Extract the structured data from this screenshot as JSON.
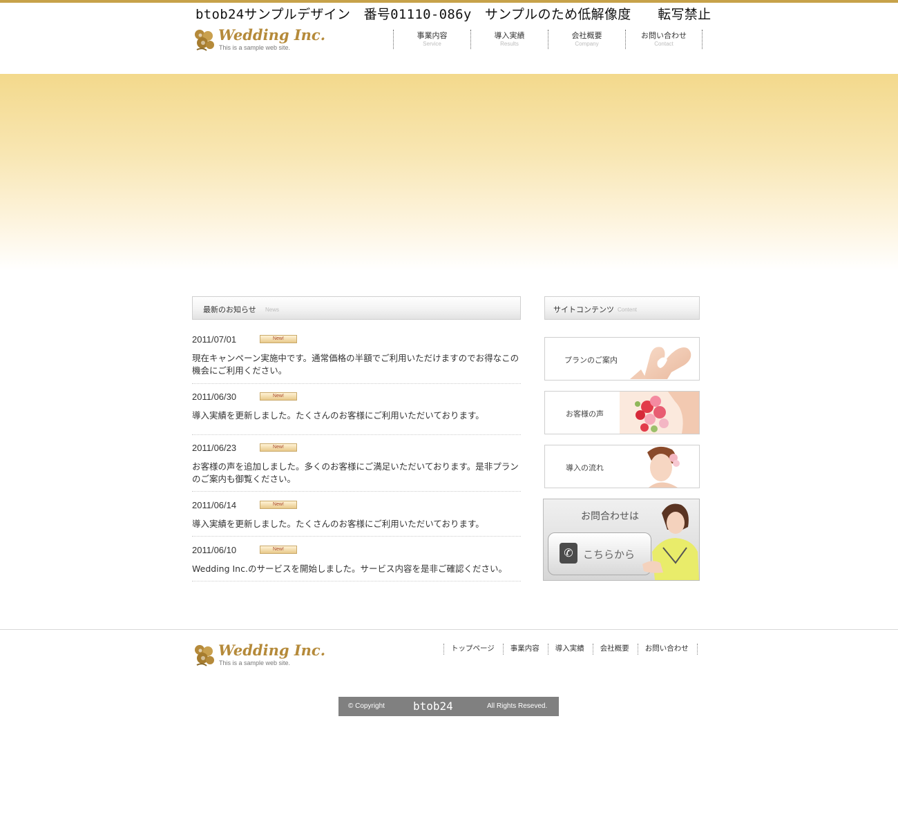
{
  "watermark": "btob24サンプルデザイン　番号01110-086y　サンプルのため低解像度　　転写禁止",
  "header": {
    "brand": "Wedding Inc.",
    "tagline": "This is a sample web site."
  },
  "nav": [
    {
      "jp": "事業内容",
      "en": "Service"
    },
    {
      "jp": "導入実績",
      "en": "Results"
    },
    {
      "jp": "会社概要",
      "en": "Company"
    },
    {
      "jp": "お問い合わせ",
      "en": "Contact"
    }
  ],
  "news": {
    "title": "最新のお知らせ",
    "title_en": "News",
    "badge": "New!",
    "items": [
      {
        "date": "2011/07/01",
        "text": "現在キャンペーン実施中です。通常価格の半額でご利用いただけますのでお得なこの機会にご利用ください。"
      },
      {
        "date": "2011/06/30",
        "text": "導入実績を更新しました。たくさんのお客様にご利用いただいております。"
      },
      {
        "date": "2011/06/23",
        "text": "お客様の声を追加しました。多くのお客様にご満足いただいております。是非プランのご案内も御覧ください。"
      },
      {
        "date": "2011/06/14",
        "text": "導入実績を更新しました。たくさんのお客様にご利用いただいております。"
      },
      {
        "date": "2011/06/10",
        "text": "Wedding Inc.のサービスを開始しました。サービス内容を是非ご確認ください。"
      }
    ]
  },
  "sidebar": {
    "title": "サイトコンテンツ",
    "title_en": "Content",
    "banners": [
      {
        "label": "プランのご案内",
        "icon": "hands-heart-image"
      },
      {
        "label": "お客様の声",
        "icon": "bouquet-image"
      },
      {
        "label": "導入の流れ",
        "icon": "bride-image"
      }
    ],
    "contact": {
      "title": "お問合わせは",
      "button": "こちらから",
      "icon": "phone-icon"
    }
  },
  "footer": {
    "brand": "Wedding Inc.",
    "tagline": "This is a sample web site.",
    "nav": [
      "トップページ",
      "事業内容",
      "導入実績",
      "会社概要",
      "お問い合わせ"
    ],
    "copyright_left": "© Copyright",
    "copyright_mid": "btob24",
    "copyright_right": "All Rights Reseved."
  },
  "colors": {
    "accent_gold": "#c7a24a",
    "hero_top": "#f3d98c",
    "copyright_bg": "#808080"
  }
}
